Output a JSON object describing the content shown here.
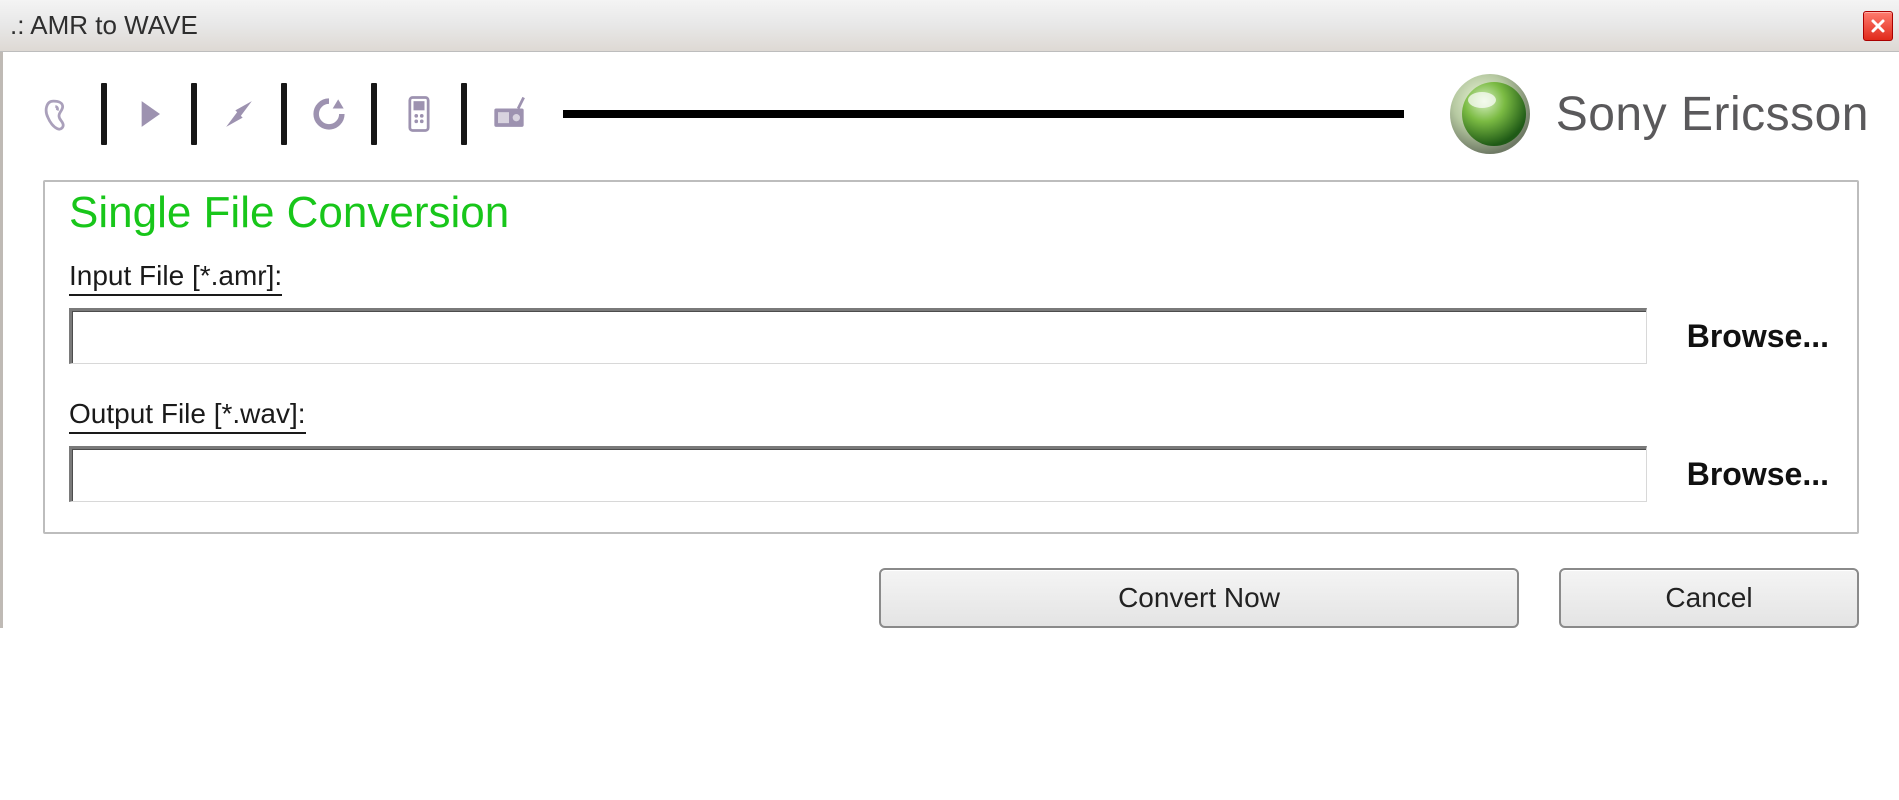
{
  "window": {
    "title": ".: AMR to WAVE"
  },
  "toolbar": {
    "icons": {
      "ear": "ear-icon",
      "play": "play-icon",
      "bolt": "bolt-icon",
      "refresh": "refresh-icon",
      "phone": "phone-icon",
      "radio": "radio-icon"
    }
  },
  "brand": {
    "name": "Sony Ericsson",
    "accent": "#4f9b2c"
  },
  "panel": {
    "title": "Single File Conversion",
    "input_label": "Input File [*.amr]:",
    "input_value": "",
    "input_browse": "Browse...",
    "output_label": "Output File [*.wav]:",
    "output_value": "",
    "output_browse": "Browse..."
  },
  "buttons": {
    "convert": "Convert Now",
    "cancel": "Cancel"
  }
}
